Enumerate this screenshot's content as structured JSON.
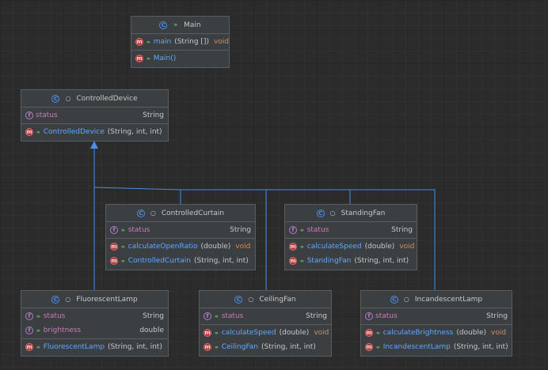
{
  "classes": {
    "main": {
      "name": "Main",
      "m1_name": "main",
      "m1_params": "(String [])",
      "m1_ret": "void",
      "m2_name": "Main()"
    },
    "controlled_device": {
      "name": "ControlledDevice",
      "f1_name": "status",
      "f1_type": "String",
      "m1_name": "ControlledDevice",
      "m1_params": "(String, int, int)"
    },
    "controlled_curtain": {
      "name": "ControlledCurtain",
      "f1_name": "status",
      "f1_type": "String",
      "m1_name": "calculateOpenRatio",
      "m1_params": "(double)",
      "m1_ret": "void",
      "m2_name": "ControlledCurtain",
      "m2_params": "(String, int, int)"
    },
    "standing_fan": {
      "name": "StandingFan",
      "f1_name": "status",
      "f1_type": "String",
      "m1_name": "calculateSpeed",
      "m1_params": "(double)",
      "m1_ret": "void",
      "m2_name": "StandingFan",
      "m2_params": "(String, int, int)"
    },
    "fluorescent_lamp": {
      "name": "FluorescentLamp",
      "f1_name": "status",
      "f1_type": "String",
      "f2_name": "brightness",
      "f2_type": "double",
      "m1_name": "FluorescentLamp",
      "m1_params": "(String, int, int)"
    },
    "ceiling_fan": {
      "name": "CeilingFan",
      "f1_name": "status",
      "f1_type": "String",
      "m1_name": "calculateSpeed",
      "m1_params": "(double)",
      "m1_ret": "void",
      "m2_name": "CeilingFan",
      "m2_params": "(String, int, int)"
    },
    "incandescent_lamp": {
      "name": "IncandescentLamp",
      "f1_name": "status",
      "f1_type": "String",
      "m1_name": "calculateBrightness",
      "m1_params": "(double)",
      "m1_ret": "void",
      "m2_name": "IncandescentLamp",
      "m2_params": "(String, int, int)"
    }
  },
  "icons": {
    "class": "C",
    "field": "f",
    "method": "m",
    "visibility": "public"
  },
  "colors": {
    "background": "#2b2b2b",
    "node": "#3c3f41",
    "inheritance_line": "#4a8de8",
    "field": "#c77dbb",
    "method": "#5fa8ff",
    "return_type": "#cc8d5f"
  }
}
